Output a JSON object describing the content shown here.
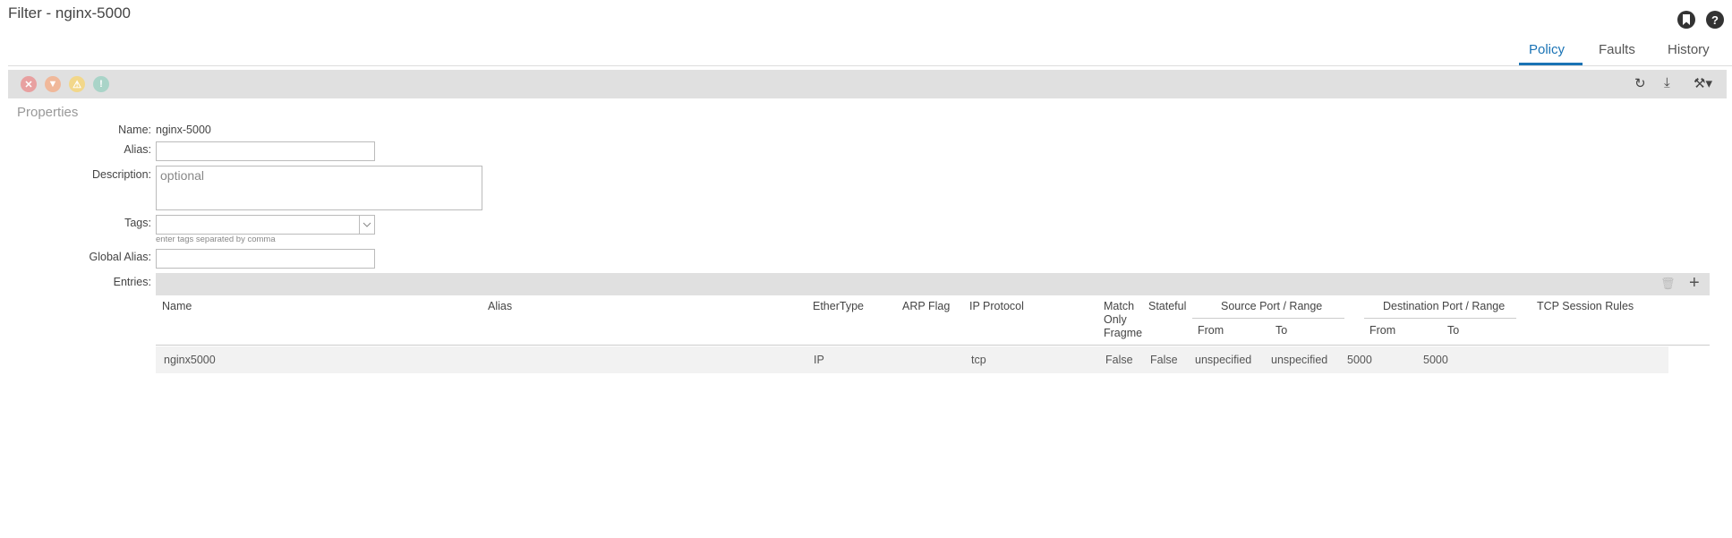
{
  "header": {
    "title": "Filter - nginx-5000",
    "icons": [
      "bookmark-icon",
      "help-icon"
    ],
    "help_glyph": "?",
    "tabs": [
      "Policy",
      "Faults",
      "History"
    ],
    "active_tab": "Policy"
  },
  "toolbar": {
    "fault_icons": [
      {
        "name": "critical-fault-icon",
        "color": "#e8a0a0",
        "glyph": "✕"
      },
      {
        "name": "major-fault-icon",
        "color": "#f0b89a",
        "glyph": "▼"
      },
      {
        "name": "minor-fault-icon",
        "color": "#f2d78a",
        "glyph": "⚠"
      },
      {
        "name": "warning-fault-icon",
        "color": "#a9d4c8",
        "glyph": "!"
      }
    ],
    "actions": [
      "refresh-icon",
      "download-icon",
      "tools-dropdown-icon"
    ],
    "refresh_glyph": "↻",
    "download_glyph": "⤓",
    "tools_glyph": "⚒▾"
  },
  "properties": {
    "section_title": "Properties",
    "name_label": "Name:",
    "name_value": "nginx-5000",
    "alias_label": "Alias:",
    "alias_value": "",
    "description_label": "Description:",
    "description_placeholder": "optional",
    "tags_label": "Tags:",
    "tags_hint": "enter tags separated by comma",
    "global_alias_label": "Global Alias:",
    "global_alias_value": "",
    "entries_label": "Entries:"
  },
  "entries": {
    "actions": [
      "delete-icon",
      "add-icon"
    ],
    "delete_glyph": "🗑",
    "add_glyph": "+",
    "columns": {
      "name": "Name",
      "alias": "Alias",
      "ethertype": "EtherType",
      "arp_flag": "ARP Flag",
      "ip_protocol": "IP Protocol",
      "match_only": "Match",
      "match_only_2": "Only",
      "match_only_3": "Fragme",
      "stateful": "Stateful",
      "source_port": "Source Port / Range",
      "source_from": "From",
      "source_to": "To",
      "dest_port": "Destination Port / Range",
      "dest_from": "From",
      "dest_to": "To",
      "tcp_rules": "TCP Session Rules"
    },
    "rows": [
      {
        "name": "nginx5000",
        "alias": "",
        "ethertype": "IP",
        "arp_flag": "",
        "ip_protocol": "tcp",
        "match_only": "False",
        "stateful": "False",
        "source_from": "unspecified",
        "source_to": "unspecified",
        "dest_from": "5000",
        "dest_to": "5000",
        "tcp_rules": ""
      }
    ]
  }
}
